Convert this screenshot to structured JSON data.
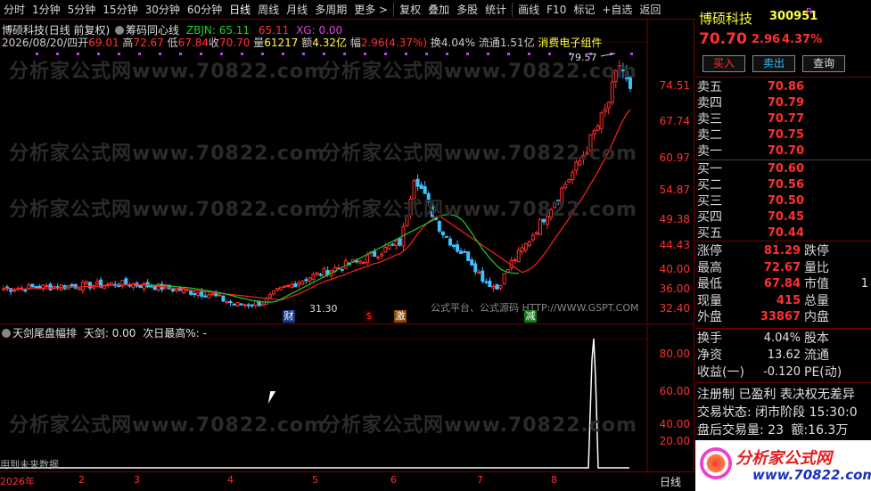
{
  "toolbar": {
    "items": [
      "分时",
      "1分钟",
      "5分钟",
      "15分钟",
      "30分钟",
      "60分钟",
      "日线",
      "周线",
      "月线",
      "多周期",
      "更多 >",
      "复权",
      "叠加",
      "多股",
      "统计",
      "画线",
      "F10",
      "标记",
      "+自选",
      "返回"
    ]
  },
  "main_chart": {
    "info_line1": {
      "name": "博硕科技",
      "mode": "(日线 前复权)",
      "indicator": "筹码同心线",
      "zbjn": "ZBJN: 65.11",
      "val2": "65.11",
      "xg": "XG: 0.00"
    },
    "info_line2": {
      "date": "2026/08/20/四",
      "open_label": "开",
      "open": "69.01",
      "high_label": "高",
      "high": "72.67",
      "low_label": "低",
      "low": "67.84",
      "close_label": "收",
      "close": "70.70",
      "vol_label": "量",
      "vol": "61217",
      "amt_label": "额",
      "amt": "4.32亿",
      "chg_label": "幅",
      "chg": "2.96(4.37%)",
      "turn_label": "换",
      "turn": "4.04%",
      "float_label": "流通",
      "float": "1.51亿",
      "sector": "消费电子组件"
    },
    "y_ticks": [
      "74.51",
      "67.74",
      "60.97",
      "54.87",
      "49.38",
      "44.43",
      "40.00",
      "36.00",
      "32.40"
    ],
    "max_label": "79.57",
    "min_label": "31.30",
    "markers": [
      "财",
      "$",
      "激",
      "减"
    ],
    "watermark": "分析家公式网www.70822.com",
    "platform_text": "公式平台、公式源码 HTTP://WWW.GSPT.COM"
  },
  "sub_chart": {
    "title": "天剑尾盘幅排",
    "tj": "天剑: 0.00",
    "next": "次日最高%: -",
    "y_ticks": [
      "80.00",
      "60.00",
      "40.00",
      "20.00"
    ],
    "note": "用到未来数据",
    "watermark": "分析家公式网www.70822.com"
  },
  "time_axis": {
    "labels": [
      "2026年",
      "2",
      "3",
      "4",
      "5",
      "6",
      "7",
      "8"
    ],
    "mode": "日线"
  },
  "quote": {
    "name": "博硕科技",
    "code": "300951",
    "flag": "R",
    "price": "70.70",
    "change": "2.96",
    "pct": "4.37%",
    "buy_btn": "买入",
    "sell_btn": "卖出",
    "query_btn": "查询",
    "asks": [
      {
        "label": "卖五",
        "price": "70.86",
        "qty": ""
      },
      {
        "label": "卖四",
        "price": "70.79",
        "qty": ""
      },
      {
        "label": "卖三",
        "price": "70.77",
        "qty": ""
      },
      {
        "label": "卖二",
        "price": "70.75",
        "qty": ""
      },
      {
        "label": "卖一",
        "price": "70.70",
        "qty": ""
      }
    ],
    "bids": [
      {
        "label": "买一",
        "price": "70.60",
        "qty": ""
      },
      {
        "label": "买二",
        "price": "70.56",
        "qty": ""
      },
      {
        "label": "买三",
        "price": "70.50",
        "qty": ""
      },
      {
        "label": "买四",
        "price": "70.45",
        "qty": ""
      },
      {
        "label": "买五",
        "price": "70.44",
        "qty": ""
      }
    ],
    "stats": [
      {
        "l1": "涨停",
        "v1": "81.29",
        "l2": "跌停",
        "v2": ""
      },
      {
        "l1": "最高",
        "v1": "72.67",
        "l2": "量比",
        "v2": ""
      },
      {
        "l1": "最低",
        "v1": "67.84",
        "l2": "市值",
        "v2": "1"
      },
      {
        "l1": "现量",
        "v1": "415",
        "l2": "总量",
        "v2": ""
      },
      {
        "l1": "外盘",
        "v1": "33867",
        "l2": "内盘",
        "v2": ""
      }
    ],
    "stats2": [
      {
        "l1": "换手",
        "v1": "4.04%",
        "l2": "股本"
      },
      {
        "l1": "净资",
        "v1": "13.62",
        "l2": "流通"
      },
      {
        "l1": "收益(一)",
        "v1": "-0.120",
        "l2": "PE(动)"
      }
    ],
    "notice": "注册制 已盈利 表决权无差异",
    "trade_status_label": "交易状态:",
    "trade_status": "闭市阶段",
    "trade_time": "15:30:0",
    "after_label": "盘后交易量:",
    "after_vol": "23",
    "after_amt_label": "额:",
    "after_amt": "16.3万",
    "logo_text": "分析家公式网",
    "logo_url": "www.70822.com"
  }
}
